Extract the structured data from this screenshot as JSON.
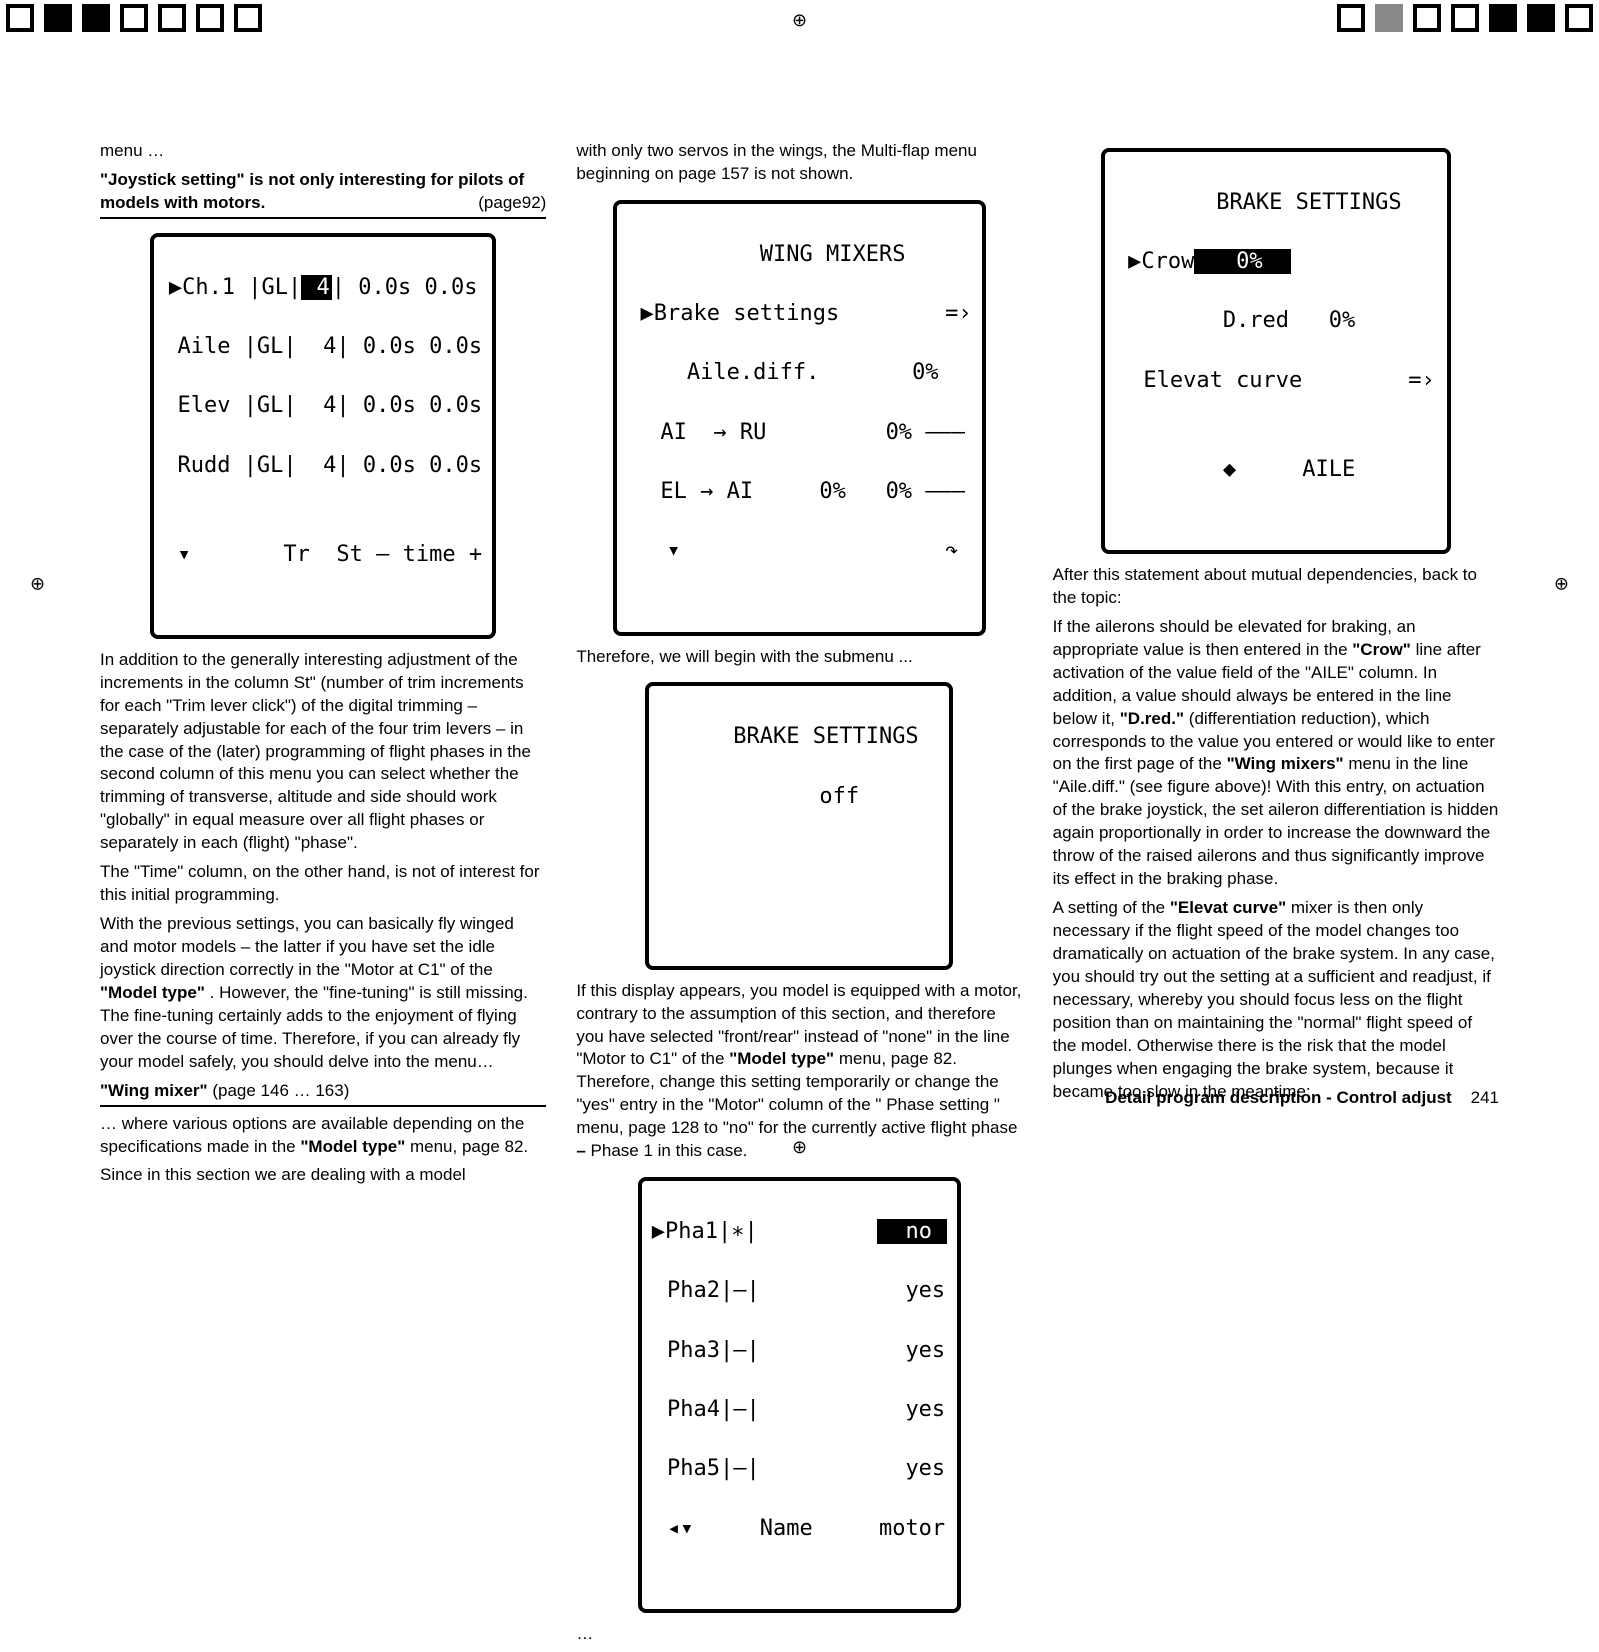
{
  "registrations": {
    "top": "⊕",
    "bottom": "⊕",
    "left": "⊕",
    "right": "⊕"
  },
  "col1": {
    "menu": "menu …",
    "heading_bold": "\"Joystick setting\" is not only interesting for pilots of models with motors.",
    "heading_right": "(page92)",
    "lcd1_rows": [
      "▶Ch.1 |GL|| 4| 0.0s 0.0s",
      " Aile |GL|  4| 0.0s 0.0s",
      " Elev |GL|  4| 0.0s 0.0s",
      " Rudd |GL|  4| 0.0s 0.0s",
      "",
      " ▾       Tr  St – time +"
    ],
    "p1": "In addition to the generally interesting adjustment of the increments in the column St\" (number of trim increments for each \"Trim lever click\") of the digital trimming – separately adjustable for each of the four trim levers – in the case of the (later) programming of flight phases in the second column of this menu you can select whether the trimming of transverse, altitude and side should work \"globally\" in equal measure over all flight phases or separately in each (flight) \"phase\".",
    "p2": "The \"Time\" column, on the other hand, is not of interest for this initial programming.",
    "p3a": "With the previous settings, you can basically fly winged and motor models – the latter if you have set the idle joystick direction correctly in the \"Motor at C1\" of the ",
    "p3b": "\"Model type\"",
    "p3c": " . However, the \"fine-tuning\" is still missing. The fine-tuning certainly adds to the enjoyment of flying over the course of time. Therefore, if you can already fly your model safely, you should delve into the menu…",
    "sub_heading": "\"Wing mixer\" (page 146 … 163)",
    "p4a": "… where various options are available depending on the specifications made in the ",
    "p4b": "\"Model type\"",
    "p4c": " menu, page 82.",
    "p5": "Since in this section we are dealing with a model"
  },
  "col2": {
    "p1": "with only two servos in the wings, the Multi-flap menu beginning on page 157 is not shown.",
    "lcd_wing_title": "     WING MIXERS",
    "lcd_wing_rows": [
      " ▶Brake settings        =›",
      "  Aile.diff.       0%",
      "  AI  → RU         0% –––",
      "  EL → AI     0%   0% –––",
      "  ▾                    ↷"
    ],
    "p2": "Therefore, we will begin with the submenu ...",
    "lcd_brake_title": "    BRAKE SETTINGS",
    "lcd_brake_rows": [
      "      off",
      "",
      "",
      ""
    ],
    "p3a": "If this display appears, you model is equipped with a motor, contrary to the assumption of this section, and therefore you have selected \"front/rear\" instead of \"none\" in the line \"Motor to C1\" of the ",
    "p3b": "\"Model type\"",
    "p3c": " menu, page 82. Therefore, change this setting temporarily or change the \"yes\" entry in the \"Motor\" column of the \" Phase setting \" menu, page 128 to \"no\" for the currently active flight phase ",
    "p3d": "–",
    "p3e": "Phase 1 in this case.",
    "lcd_phase_rows": [
      "▶Pha1|∗|            no ",
      " Pha2|–|           yes",
      " Pha3|–|           yes",
      " Pha4|–|           yes",
      " Pha5|–|           yes",
      " ◂▾     Name     motor"
    ],
    "dots": "…"
  },
  "col3": {
    "lcd_rows": [
      "     BRAKE SETTINGS",
      " ▶Crow    0%           ",
      "  D.red   0%",
      "  Elevat curve        =›",
      "",
      "  ◆     AILE"
    ],
    "lcd_crow_inv": "   0%  ",
    "p1": "After this statement about mutual dependencies, back to the topic:",
    "p2a": "If the ailerons should be elevated for braking, an appropriate value is then entered in the ",
    "p2b": "\"Crow\"",
    "p2c": " line after activation of the value field of the \"AILE\" column. In addition, a value should always be entered in the line below it, ",
    "p2d": "\"D.red.\"",
    "p2e": " (differentiation reduction), which corresponds to the value you entered or would like to enter on the first page of the ",
    "p2f": "\"Wing mixers\"",
    "p2g": " menu in the line \"Aile.diff.\" (see figure above)! With this entry, on actuation of the brake joystick, the set aileron differentiation is hidden again proportionally in order to increase the downward the throw of the raised ailerons and thus significantly improve its effect in the braking phase.",
    "p3a": "A setting of the ",
    "p3b": "\"Elevat curve\"",
    "p3c": " mixer is then only necessary if the flight speed of the model changes too dramatically on actuation of the brake system. In any case, you should try out the setting at a sufficient and readjust, if necessary, whereby you should focus less on the flight position than on maintaining the \"normal\" flight speed of the model. Otherwise there is the risk that the model plunges when engaging the brake system, because it became too slow in the meantime:"
  },
  "footer": {
    "title": "Detail program description - Control adjust",
    "page": "241"
  }
}
